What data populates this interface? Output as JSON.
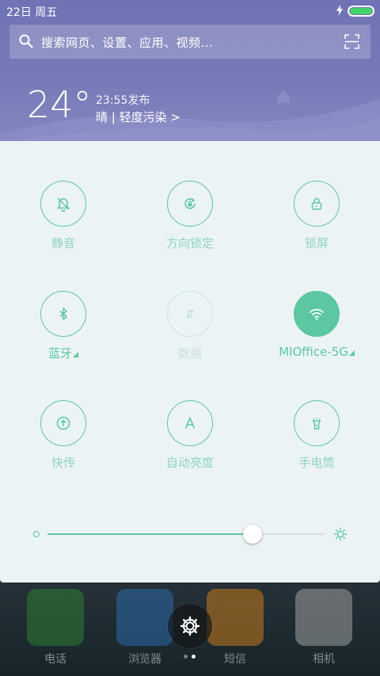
{
  "status": {
    "date": "22日  周五",
    "battery_level": 1.0
  },
  "search": {
    "placeholder": "搜索网页、设置、应用、视频..."
  },
  "weather": {
    "temperature": "24°",
    "publish_time": "23:55发布",
    "condition": "晴 | 轻度污染 >"
  },
  "quick_settings": {
    "tiles": [
      {
        "id": "mute",
        "label": "静音",
        "icon": "bell-off-icon",
        "state": "off"
      },
      {
        "id": "rotation",
        "label": "方向锁定",
        "icon": "rotation-lock-icon",
        "state": "off"
      },
      {
        "id": "lock",
        "label": "锁屏",
        "icon": "lock-icon",
        "state": "off"
      },
      {
        "id": "bluetooth",
        "label": "蓝牙",
        "icon": "bluetooth-icon",
        "state": "off"
      },
      {
        "id": "data",
        "label": "数据",
        "icon": "data-arrows-icon",
        "state": "disabled"
      },
      {
        "id": "wifi",
        "label": "MIOffice-5G",
        "icon": "wifi-icon",
        "state": "on"
      },
      {
        "id": "share",
        "label": "快传",
        "icon": "upload-icon",
        "state": "off"
      },
      {
        "id": "auto_brightness",
        "label": "自动亮度",
        "icon": "letter-a-icon",
        "state": "off"
      },
      {
        "id": "flashlight",
        "label": "手电筒",
        "icon": "flashlight-icon",
        "state": "off"
      }
    ],
    "brightness": 0.74
  },
  "dock": {
    "apps": [
      {
        "name": "电话",
        "icon": "phone-icon",
        "color": "#2e7d32"
      },
      {
        "name": "浏览器",
        "icon": "browser-icon",
        "color": "#2b6aa8"
      },
      {
        "name": "短信",
        "icon": "message-icon",
        "color": "#c77a1c"
      },
      {
        "name": "相机",
        "icon": "camera-icon",
        "color": "#9e9e9e"
      }
    ]
  },
  "colors": {
    "accent": "#5cc7a1",
    "panel": "#ecf3f5",
    "header": "#7377b6"
  }
}
